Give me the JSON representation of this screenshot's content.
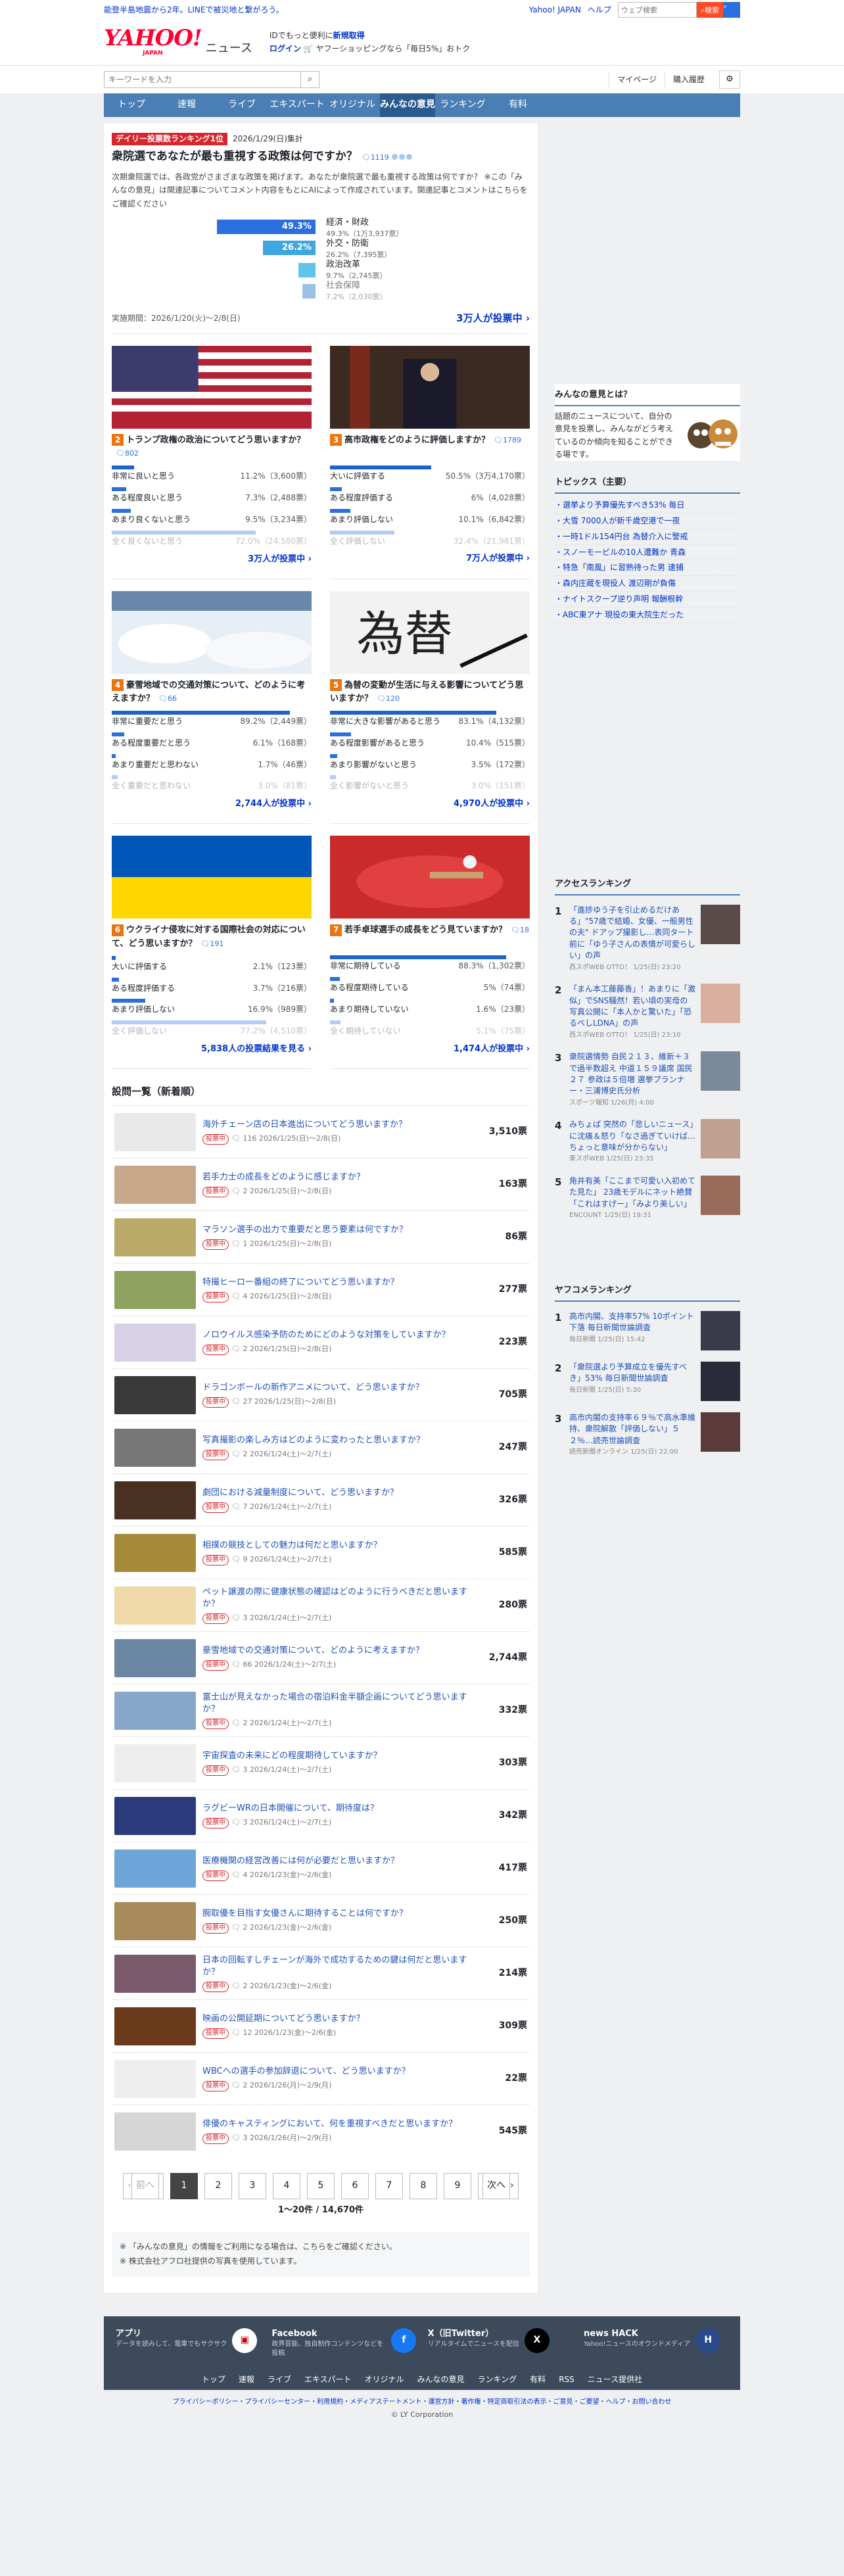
{
  "top": {
    "notice": "能登半島地震から2年。LINEで被災地と繋がろう。",
    "links": [
      "Yahoo! JAPAN",
      "ヘルプ"
    ],
    "search_placeholder": "ウェブ検索",
    "search_btn": "検索"
  },
  "header": {
    "logo_y": "YAHOO!",
    "logo_j": "JAPAN",
    "logo_news": "ニュース",
    "promo1": "IDでもっと便利に",
    "promo1b": "新規取得",
    "login": "ログイン",
    "promo2": "ヤフーショッピングなら「毎日5%」おトク"
  },
  "searchrow": {
    "placeholder": "キーワードを入力",
    "mypage": "マイページ",
    "history": "購入履歴"
  },
  "nav": [
    "トップ",
    "速報",
    "ライブ",
    "エキスパート",
    "オリジナル",
    "みんなの意見",
    "ランキング",
    "有料"
  ],
  "lead": {
    "badge": "デイリー投票数ランキング1位",
    "date": "2026/1/29(日)集計",
    "question": "衆院選であなたが最も重視する政策は何ですか？",
    "comments": "1119",
    "desc": "次期衆院選では、各政党がさまざまな政策を掲げます。あなたが衆院選で最も重視する政策は何ですか？ ※この「みんなの意見」は関連記事についてコメント内容をもとにAIによって作成されています。関連記事とコメントはこちらをご確認ください",
    "bars": [
      {
        "label": "経済・財政",
        "pct": "49.3%",
        "votes": "49.3%（1万3,937票）",
        "color": "#2b6fdf"
      },
      {
        "label": "外交・防衛",
        "pct": "26.2%",
        "votes": "26.2%（7,395票）",
        "color": "#3fa7e0"
      },
      {
        "label": "政治改革",
        "votes": "9.7%（2,745票）",
        "color": "#5fc4e8"
      },
      {
        "label": "社会保障",
        "votes": "7.2%（2,030票）",
        "color": "#9ac0e6"
      }
    ],
    "period": "実施期間：2026/1/20(火)〜2/8(日)",
    "total": "3万人が投票中"
  },
  "cards": [
    {
      "num": "2",
      "q": "トランプ政権の政治についてどう思いますか？",
      "cc": "802",
      "opts": [
        [
          "非常に良いと思う",
          "11.2%（3,600票）"
        ],
        [
          "ある程度良いと思う",
          "7.3%（2,488票）"
        ],
        [
          "あまり良くないと思う",
          "9.5%（3,234票）"
        ],
        [
          "全く良くないと思う",
          "72.0%（24,580票）"
        ]
      ],
      "fills": [
        0.112,
        0.073,
        0.095,
        0.72
      ],
      "tot": "3万人が投票中"
    },
    {
      "num": "3",
      "q": "高市政権をどのように評価しますか？",
      "cc": "1789",
      "opts": [
        [
          "大いに評価する",
          "50.5%（3万4,170票）"
        ],
        [
          "ある程度評価する",
          "6%（4,028票）"
        ],
        [
          "あまり評価しない",
          "10.1%（6,842票）"
        ],
        [
          "全く評価しない",
          "32.4%（21,981票）"
        ]
      ],
      "fills": [
        0.505,
        0.06,
        0.101,
        0.324
      ],
      "tot": "7万人が投票中"
    },
    {
      "num": "4",
      "q": "豪雪地域での交通対策について、どのように考えますか？",
      "cc": "66",
      "opts": [
        [
          "非常に重要だと思う",
          "89.2%（2,449票）"
        ],
        [
          "ある程度重要だと思う",
          "6.1%（168票）"
        ],
        [
          "あまり重要だと思わない",
          "1.7%（46票）"
        ],
        [
          "全く重要だと思わない",
          "3.0%（81票）"
        ]
      ],
      "fills": [
        0.892,
        0.061,
        0.017,
        0.03
      ],
      "tot": "2,744人が投票中"
    },
    {
      "num": "5",
      "q": "為替の変動が生活に与える影響についてどう思いますか？",
      "cc": "120",
      "opts": [
        [
          "非常に大きな影響があると思う",
          "83.1%（4,132票）"
        ],
        [
          "ある程度影響があると思う",
          "10.4%（515票）"
        ],
        [
          "あまり影響がないと思う",
          "3.5%（172票）"
        ],
        [
          "全く影響がないと思う",
          "3.0%（151票）"
        ]
      ],
      "fills": [
        0.831,
        0.104,
        0.035,
        0.03
      ],
      "tot": "4,970人が投票中"
    },
    {
      "num": "6",
      "q": "ウクライナ侵攻に対する国際社会の対応について、どう思いますか？",
      "cc": "191",
      "opts": [
        [
          "大いに評価する",
          "2.1%（123票）"
        ],
        [
          "ある程度評価する",
          "3.7%（216票）"
        ],
        [
          "あまり評価しない",
          "16.9%（989票）"
        ],
        [
          "全く評価しない",
          "77.2%（4,510票）"
        ]
      ],
      "fills": [
        0.021,
        0.037,
        0.169,
        0.772
      ],
      "tot": "5,838人の投票結果を見る"
    },
    {
      "num": "7",
      "q": "若手卓球選手の成長をどう見ていますか？",
      "cc": "18",
      "opts": [
        [
          "非常に期待している",
          "88.3%（1,302票）"
        ],
        [
          "ある程度期待している",
          "5%（74票）"
        ],
        [
          "あまり期待していない",
          "1.6%（23票）"
        ],
        [
          "全く期待していない",
          "5.1%（75票）"
        ]
      ],
      "fills": [
        0.883,
        0.05,
        0.016,
        0.051
      ],
      "tot": "1,474人が投票中"
    }
  ],
  "list_title": "設問一覧（新着順）",
  "list": [
    {
      "q": "海外チェーン店の日本進出についてどう思いますか？",
      "meta": "116  2026/1/25(日)〜2/8(日)",
      "v": "3,510票",
      "c": "#e9e9e9"
    },
    {
      "q": "若手力士の成長をどのように感じますか？",
      "meta": "2  2026/1/25(日)〜2/8(日)",
      "v": "163票",
      "c": "#c8a88a"
    },
    {
      "q": "マラソン選手の出力で重要だと思う要素は何ですか？",
      "meta": "1  2026/1/25(日)〜2/8(日)",
      "v": "86票",
      "c": "#b9aa6a"
    },
    {
      "q": "特撮ヒーロー番組の終了についてどう思いますか？",
      "meta": "4  2026/1/25(日)〜2/8(日)",
      "v": "277票",
      "c": "#8fa260"
    },
    {
      "q": "ノロウイルス感染予防のためにどのような対策をしていますか？",
      "meta": "2  2026/1/25(日)〜2/8(日)",
      "v": "223票",
      "c": "#d7d0e6"
    },
    {
      "q": "ドラゴンボールの新作アニメについて、どう思いますか？",
      "meta": "27  2026/1/25(日)〜2/8(日)",
      "v": "705票",
      "c": "#3a3a3a"
    },
    {
      "q": "写真撮影の楽しみ方はどのように変わったと思いますか？",
      "meta": "2  2026/1/24(土)〜2/7(土)",
      "v": "247票",
      "c": "#777777"
    },
    {
      "q": "劇団における減量制度について、どう思いますか？",
      "meta": "7  2026/1/24(土)〜2/7(土)",
      "v": "326票",
      "c": "#4a3020"
    },
    {
      "q": "相撲の競技としての魅力は何だと思いますか？",
      "meta": "9  2026/1/24(土)〜2/7(土)",
      "v": "585票",
      "c": "#a58a3a"
    },
    {
      "q": "ペット譲渡の際に健康状態の確認はどのように行うべきだと思いますか？",
      "meta": "3  2026/1/24(土)〜2/7(土)",
      "v": "280票",
      "c": "#f0d9a8"
    },
    {
      "q": "豪雪地域での交通対策について、どのように考えますか？",
      "meta": "66  2026/1/24(土)〜2/7(土)",
      "v": "2,744票",
      "c": "#6b86a3"
    },
    {
      "q": "富士山が見えなかった場合の宿泊料金半額企画についてどう思いますか？",
      "meta": "2  2026/1/24(土)〜2/7(土)",
      "v": "332票",
      "c": "#87a7c9"
    },
    {
      "q": "宇宙探査の未来にどの程度期待していますか？",
      "meta": "3  2026/1/24(土)〜2/7(土)",
      "v": "303票",
      "c": "#eeeeee"
    },
    {
      "q": "ラグビーWRの日本開催について、期待度は？",
      "meta": "3  2026/1/24(土)〜2/7(土)",
      "v": "342票",
      "c": "#2a3a7a"
    },
    {
      "q": "医療機関の経営改善には何が必要だと思いますか？",
      "meta": "4  2026/1/23(金)〜2/6(金)",
      "v": "417票",
      "c": "#6ea5d8"
    },
    {
      "q": "腕取優を目指す女優さんに期待することは何ですか？",
      "meta": "2  2026/1/23(金)〜2/6(金)",
      "v": "250票",
      "c": "#a98a5a"
    },
    {
      "q": "日本の回転すしチェーンが海外で成功するための鍵は何だと思いますか？",
      "meta": "2  2026/1/23(金)〜2/6(金)",
      "v": "214票",
      "c": "#7a5a6a"
    },
    {
      "q": "映画の公開延期についてどう思いますか？",
      "meta": "12  2026/1/23(金)〜2/6(金)",
      "v": "309票",
      "c": "#6a3a1a"
    },
    {
      "q": "WBCへの選手の参加辞退について、どう思いますか？",
      "meta": "2  2026/1/26(月)〜2/9(月)",
      "v": "22票",
      "c": "#eeeeee"
    },
    {
      "q": "俳優のキャスティングにおいて、何を重視すべきだと思いますか？",
      "meta": "3  2026/1/26(月)〜2/9(月)",
      "v": "545票",
      "c": "#d6d6d6"
    }
  ],
  "list_tag": "投票中",
  "pager": {
    "prev": "前へ",
    "pages": [
      "1",
      "2",
      "3",
      "4",
      "5",
      "6",
      "7",
      "8",
      "9"
    ],
    "next": "次へ",
    "count": "1〜20件 / 14,670件"
  },
  "notes": [
    "「みんなの意見」の情報をご利用になる場合は、こちらをご確認ください。",
    "株式会社アフロ社提供の写真を使用しています。"
  ],
  "side": {
    "intro_h": "みんなの意見とは？",
    "intro": "話題のニュースについて、自分の意見を投票し、みんながどう考えているのか傾向を知ることができる場です。",
    "topics_h": "トピックス（主要）",
    "topics": [
      "選挙より予算優先すべき53% 毎日",
      "大雪 7000人が新千歳空港で一夜",
      "一時1ドル154円台 為替介入に警戒",
      "スノーモービルの10人遭難か 青森",
      "特急「南風」に習熟待った男 逮捕",
      "森内庄蔵を現役人 渡辺剛が負傷",
      "ナイトスクープ逆り声明 報酬根幹",
      "ABC東アナ 現役の東大院生だった"
    ],
    "access_h": "アクセスランキング",
    "access": [
      {
        "t": "「進捗ゆう子を引止めるだけある」\"57歳で結婚、女優、一般男性の夫\" ドアップ撮影し…表同タート前に「ゆう子さんの表情が可愛らしい」の声",
        "s": "西スポWEB OTTO！ 1/25(日) 23:20",
        "c": "#5a4a4a"
      },
      {
        "t": "「まん本工藤藤香」！あまりに「激似」でSNS騒然！若い頃の実母の写真公開に「本人かと驚いた」「恐るべしLDNA」の声",
        "s": "西スポWEB OTTO！ 1/25(日) 23:10",
        "c": "#d9b0a0"
      },
      {
        "t": "衆院選情勢 自民２１３、維新＋３で過半数超え 中道１５９議席 国民２７ 参政は５倍増 選挙プランナー・三浦博史氏分析",
        "s": "スポーツ報知 1/26(月) 4:00",
        "c": "#7a8a9a"
      },
      {
        "t": "みちょぱ 突然の「悲しいニュース」に沈痛＆怒り「なさ過ぎていけば…ちょっと意味が分からない」",
        "s": "東スポWEB 1/25(日) 23:35",
        "c": "#c0a090"
      },
      {
        "t": "角井有美「ここまで可愛い入初めてた見た」 23歳モデルにネット絶賛「これはすげー」「みより美しい」",
        "s": "ENCOUNT 1/25(日) 19:31",
        "c": "#9a6a5a"
      }
    ],
    "yako_h": "ヤフコメランキング",
    "yako": [
      {
        "t": "高市内閣、支持率57% 10ポイント下落 毎日新聞世論調査",
        "s": "毎日新聞 1/25(日) 15:42",
        "c": "#3a3a4a"
      },
      {
        "t": "「衆院選より予算成立を優先すべき」53% 毎日新聞世論調査",
        "s": "毎日新聞 1/25(日) 5:30",
        "c": "#2a2a3a"
      },
      {
        "t": "高市内閣の支持率６９％で高水準維持、衆院解散「評価しない」５２％…読売世論調査",
        "s": "読売新聞オンライン 1/25(日) 22:00",
        "c": "#5a3a3a"
      }
    ]
  },
  "footer": {
    "apps": [
      {
        "h": "アプリ",
        "p": "データを読みして、電車でもサクサク"
      },
      {
        "h": "Facebook",
        "p": "政界芸能、独自制作コンテンツなどを投稿"
      },
      {
        "h": "X（旧Twitter）",
        "p": "リアルタイムでニュースを配信"
      },
      {
        "h": "news HACK",
        "p": "Yahoo!ニュースのオウンドメディア"
      }
    ],
    "nav": [
      "トップ",
      "速報",
      "ライブ",
      "エキスパート",
      "オリジナル",
      "みんなの意見",
      "ランキング",
      "有料",
      "RSS",
      "ニュース提供社"
    ],
    "links": "プライバシーポリシー・プライバシーセンター・利用規約・メディアステートメント・運営方針・著作権・特定商取引法の表示・ご意見・ご要望・ヘルプ・お問い合わせ",
    "copy": "© LY Corporation"
  }
}
